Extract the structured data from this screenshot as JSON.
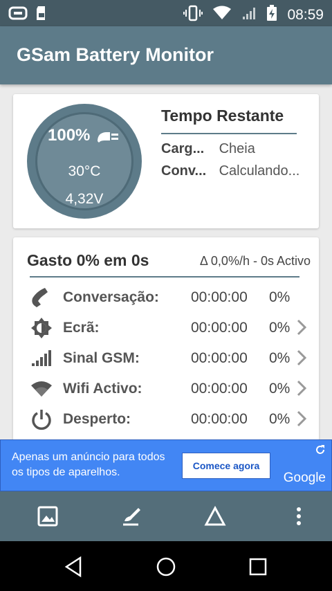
{
  "status_bar": {
    "time": "08:59",
    "icons": [
      "notification-icon",
      "sdcard-icon",
      "vibrate-icon",
      "wifi-icon",
      "signal-icon",
      "battery-charging-icon"
    ]
  },
  "app_bar": {
    "title": "GSam Battery Monitor"
  },
  "battery_card": {
    "percent": "100%",
    "temperature": "30°C",
    "voltage": "4,32V",
    "remaining_title": "Tempo Restante",
    "rows": [
      {
        "key": "Carg...",
        "value": "Cheia"
      },
      {
        "key": "Conv...",
        "value": "Calculando..."
      }
    ]
  },
  "usage_card": {
    "title": "Gasto 0% em 0s",
    "rate": "Δ 0,0%/h - 0s Activo",
    "rows": [
      {
        "icon": "phone-icon",
        "name": "Conversação:",
        "duration": "00:00:00",
        "percent": "0%"
      },
      {
        "icon": "brightness-icon",
        "name": "Ecrã:",
        "duration": "00:00:00",
        "percent": "0%"
      },
      {
        "icon": "signal-bars-icon",
        "name": "Sinal GSM:",
        "duration": "00:00:00",
        "percent": "0%"
      },
      {
        "icon": "wifi-icon",
        "name": "Wifi Activo:",
        "duration": "00:00:00",
        "percent": "0%"
      },
      {
        "icon": "power-icon",
        "name": "Desperto:",
        "duration": "00:00:00",
        "percent": "0%"
      }
    ]
  },
  "ad": {
    "text": "Apenas um anúncio para todos os tipos de aparelhos.",
    "button": "Comece agora",
    "brand": "Google"
  },
  "toolbar": {
    "items": [
      "image-icon",
      "brush-icon",
      "triangle-icon",
      "more-vert-icon"
    ]
  },
  "nav_bar": {
    "items": [
      "back-icon",
      "home-icon",
      "recents-icon"
    ]
  },
  "colors": {
    "primary": "#5d7b89",
    "status": "#455a64",
    "toolbar": "#546e7a",
    "ad": "#4286f4"
  }
}
